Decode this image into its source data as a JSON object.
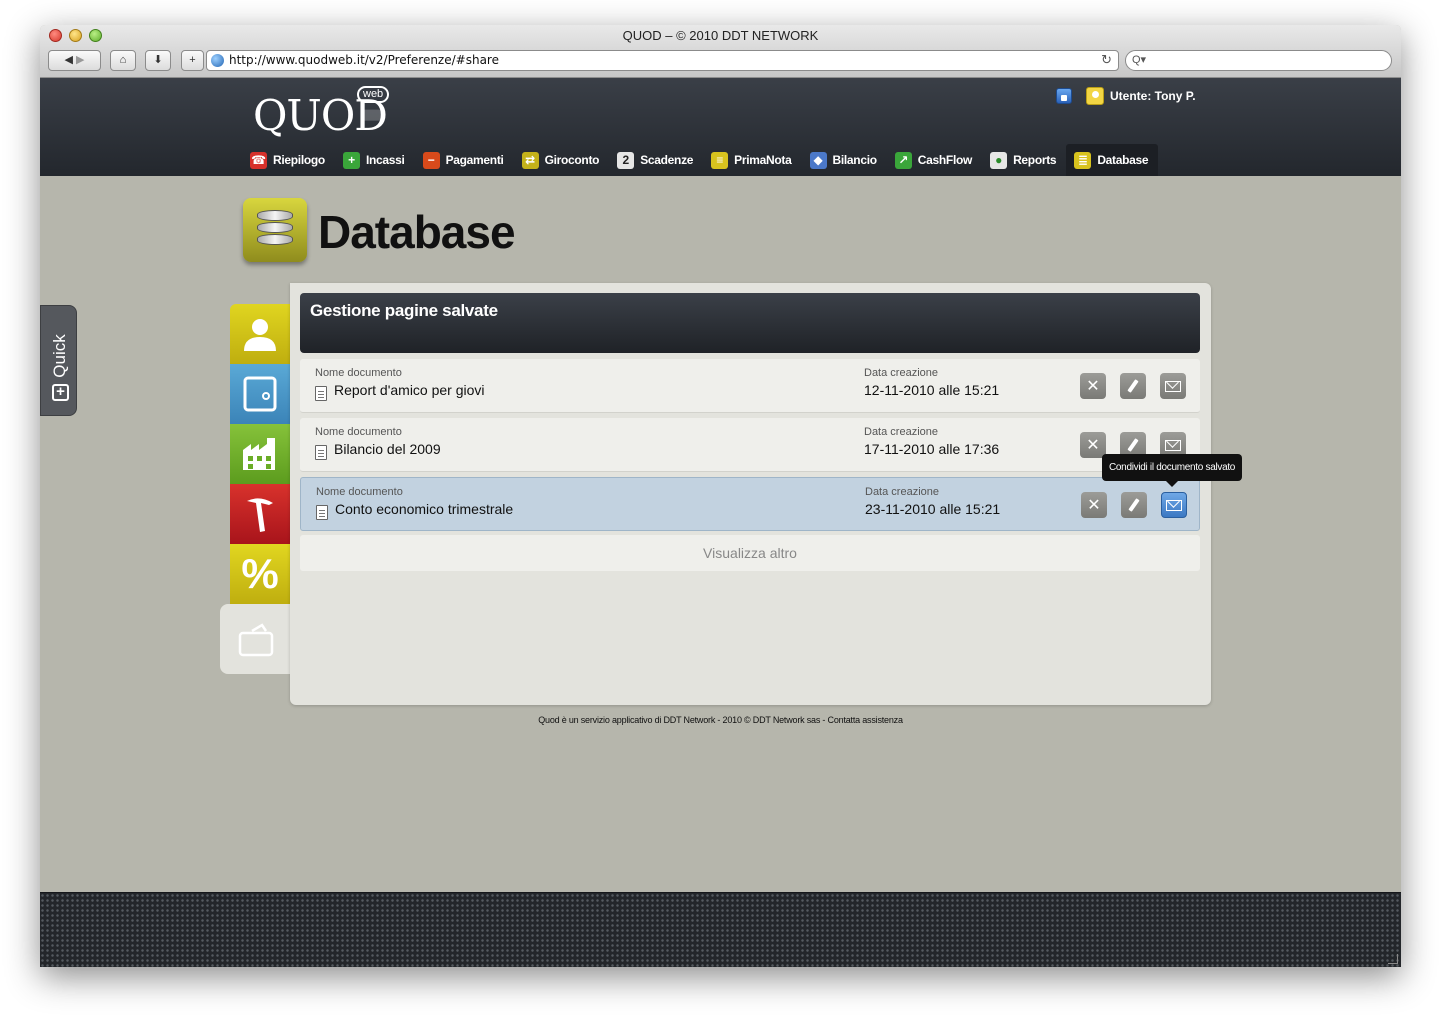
{
  "browser": {
    "window_title": "QUOD – © 2010 DDT NETWORK",
    "url": "http://www.quodweb.it/v2/Preferenze/#share",
    "search_glyph": "Q▾"
  },
  "header": {
    "logo": "QUOD",
    "logo_badge": "web",
    "user_label": "Utente: Tony P."
  },
  "nav": {
    "items": [
      {
        "label": "Riepilogo",
        "icon": "summary-icon",
        "color": "#d7312b"
      },
      {
        "label": "Incassi",
        "icon": "plus-icon",
        "color": "#3aa63a"
      },
      {
        "label": "Pagamenti",
        "icon": "minus-icon",
        "color": "#d84a1b"
      },
      {
        "label": "Giroconto",
        "icon": "transfer-icon",
        "color": "#c4b21a"
      },
      {
        "label": "Scadenze",
        "icon": "calendar-icon",
        "color": "#e6e6e6"
      },
      {
        "label": "PrimaNota",
        "icon": "ledger-icon",
        "color": "#d8c31e"
      },
      {
        "label": "Bilancio",
        "icon": "balance-icon",
        "color": "#4b78c8"
      },
      {
        "label": "CashFlow",
        "icon": "cashflow-icon",
        "color": "#3aa63a"
      },
      {
        "label": "Reports",
        "icon": "reports-icon",
        "color": "#e6e6e6"
      },
      {
        "label": "Database",
        "icon": "database-icon",
        "color": "#d8c31e"
      }
    ],
    "active": "Database"
  },
  "page": {
    "title": "Database",
    "quick_label": "Quick"
  },
  "panel": {
    "title": "Gestione pagine salvate",
    "name_header": "Nome documento",
    "date_header": "Data creazione",
    "rows": [
      {
        "name": "Report d'amico per giovi",
        "date": "12-11-2010 alle 15:21"
      },
      {
        "name": "Bilancio del 2009",
        "date": "17-11-2010 alle 17:36"
      },
      {
        "name": "Conto economico trimestrale",
        "date": "23-11-2010 alle 15:21"
      }
    ],
    "more_label": "Visualizza altro",
    "tooltip": "Condividi il documento salvato"
  },
  "footer": {
    "text": "Quod è un servizio applicativo di DDT Network - 2010 © DDT Network sas - Contatta assistenza"
  }
}
